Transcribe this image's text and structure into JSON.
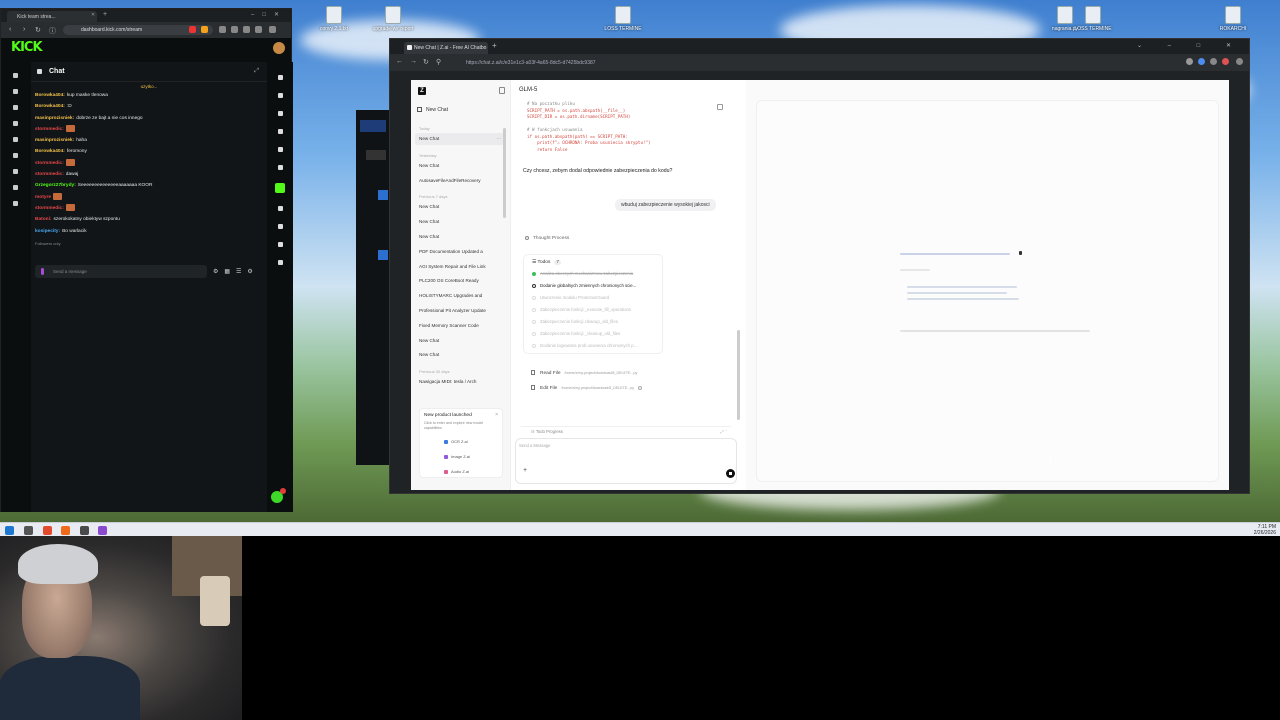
{
  "kick": {
    "tab_title": "Kick team strea...",
    "url": "dashboard.kick.com/stream",
    "logo": "KICK",
    "chat_title": "Chat",
    "pinned": "uzytko...",
    "messages": [
      {
        "user": "Borowka404:",
        "text": "kup maske tlenowa",
        "color": "#f2c14a"
      },
      {
        "user": "Borowka404:",
        "text": ":D",
        "color": "#f2c14a"
      },
      {
        "user": "masinprozisniek:",
        "text": "dobrze ze bajt a nie cos innego",
        "color": "#f2c14a"
      },
      {
        "user": "stormmedic:",
        "text": "",
        "color": "#e8474a",
        "emote": true
      },
      {
        "user": "masinprozisniek:",
        "text": "haha",
        "color": "#f2c14a"
      },
      {
        "user": "Borowka404:",
        "text": "feromony",
        "color": "#f2c14a"
      },
      {
        "user": "stormmedic:",
        "text": "",
        "color": "#e8474a",
        "emote": true
      },
      {
        "user": "stormmedic:",
        "text": "dawaj",
        "color": "#e8474a"
      },
      {
        "user": "Grzegorz27brydy:",
        "text": "Seeeeeeeeeeeeeeaaaaaaa KOOR",
        "color": "#53fc18"
      },
      {
        "user": "motyre",
        "text": "",
        "color": "#e8474a",
        "emote": true
      },
      {
        "user": "stormmedic:",
        "text": "",
        "color": "#e8474a",
        "emote": true
      },
      {
        "user": "Batoni:",
        "text": "szerokokatny obiektyw szpontu",
        "color": "#e8474a"
      },
      {
        "user": "kosipecity:",
        "text": "Bo warlacik",
        "color": "#4aa8f2"
      }
    ],
    "followers_only": "Followers only",
    "send_placeholder": "Send a message"
  },
  "browser": {
    "tab_title": "New Chat | Z.ai - Free AI Chatbo",
    "url": "https://chat.z.ai/c/e31e1c3-a03f-4a65-8dc5-d7425bdc9387"
  },
  "sidebar": {
    "new_chat": "New Chat",
    "sections": {
      "today": "Today",
      "yesterday": "Yesterday",
      "previous7": "Previous 7 days",
      "previous30": "Previous 30 days"
    },
    "today_items": [
      "New Chat"
    ],
    "yesterday_items": [
      "New Chat",
      "AutosaveFileAndFileRecovery"
    ],
    "previous7_items": [
      "New Chat",
      "New Chat",
      "New Chat",
      "PDF Documentation Updated a",
      "AGI System Repair and File Link",
      "PLC200 OS CoreBoot Ready",
      "HOLISTYMARC Upgrades and",
      "Professional Pit Analyzer Update",
      "Fixed Memory Scanner Code",
      "New Chat",
      "New Chat"
    ],
    "previous30_items": [
      "Nawigacja MIDI: tesla / Arch"
    ],
    "promo": {
      "title": "New product launched",
      "close": "×",
      "subtitle": "Click to enter and explore new model capabilities",
      "pills": [
        {
          "label": "OCR Z.ai",
          "color": "#3b7be0"
        },
        {
          "label": "Image Z.ai",
          "color": "#8f5ae0"
        },
        {
          "label": "Audio Z.ai",
          "color": "#e05a8f"
        }
      ]
    }
  },
  "chat": {
    "model": "GLM-5",
    "code_lines": [
      {
        "t": "# Na poczatku pliku",
        "c": "c-com"
      },
      {
        "t": "SCRIPT_PATH = os.path.abspath(__file__)",
        "c": "c-red"
      },
      {
        "t": "SCRIPT_DIR = os.path.dirname(SCRIPT_PATH)",
        "c": "c-red"
      },
      {
        "t": "",
        "c": ""
      },
      {
        "t": "# W funkcjach usuwania",
        "c": "c-com"
      },
      {
        "t": "if os.path.abspath(path) == SCRIPT_PATH:",
        "c": "c-red"
      },
      {
        "t": "    print(f\"⚠ OCHRONA: Proba usuniecia skryptu!\")",
        "c": "c-red"
      },
      {
        "t": "    return False",
        "c": "c-red"
      }
    ],
    "question": "Czy chcesz, zebym dodal odpowiednie zabezpieczenia do kodu?",
    "user_message": "wbuduj zabezpieczenie wysokiej jakosci",
    "thought": "Thought Process",
    "todos_label": "Todos",
    "todos_count": "7",
    "todos": [
      {
        "label": "Analiza obecnych mechanizmow zabezpieczenia",
        "state": "done"
      },
      {
        "label": "Dodanie globalnych zmiennych chronionych scie...",
        "state": "cur"
      },
      {
        "label": "Utworzenie modulu ProtectionGuard",
        "state": "pend"
      },
      {
        "label": "Zabezpieczenie funkcji _execute_fill_operations",
        "state": "pend"
      },
      {
        "label": "Zabezpieczenie funkcji cleanup_old_files",
        "state": "pend"
      },
      {
        "label": "Zabezpieczenie funkcji _cleanup_old_files",
        "state": "pend"
      },
      {
        "label": "Dodanie logowania prob usuniecia chronionych p...",
        "state": "pend"
      }
    ],
    "tools": [
      {
        "label": "Read File",
        "arg": "/home/z/my-project/download/8_DELETE...py"
      },
      {
        "label": "Edit File",
        "arg": "/home/z/my-project/download/8_DELETE...py"
      }
    ],
    "todo_progress": "Todo Progress",
    "input_placeholder": "Send a Message"
  },
  "desktop": {
    "icons": [
      "convy 2.1.txt",
      "upgrade-wir\nreport",
      "LOSS TERMINE",
      "LOSS TERMINE",
      "nagrania.py",
      "LOSS TERMINE",
      "ROKARCHI"
    ]
  },
  "tray": {
    "time": "7:11 PM",
    "date": "2/26/2026"
  }
}
